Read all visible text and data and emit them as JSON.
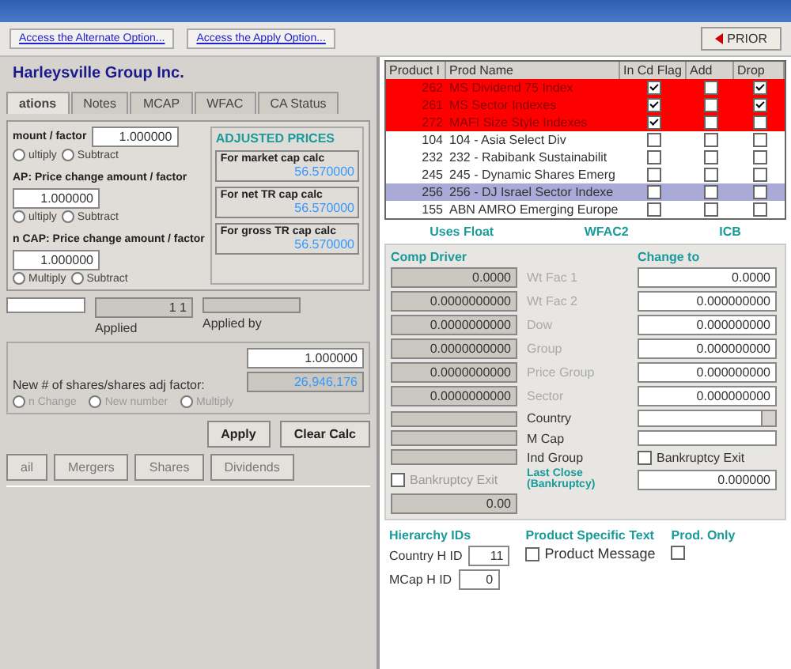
{
  "toolbar": {
    "links": [
      "Access the Alternate Option...",
      "Access the Apply Option..."
    ],
    "prior_button": "PRIOR"
  },
  "company_title": "Harleysville Group Inc.",
  "tabs": [
    {
      "label": "ations",
      "selected": true
    },
    {
      "label": "Notes",
      "selected": false
    },
    {
      "label": "MCAP",
      "selected": false
    },
    {
      "label": "WFAC",
      "selected": false
    },
    {
      "label": "CA Status",
      "selected": false
    }
  ],
  "price_adjustments": [
    {
      "label": "mount / factor",
      "options": [
        {
          "label": "ultiply",
          "selected": false
        },
        {
          "label": "Subtract",
          "selected": false
        }
      ],
      "value": "1.000000"
    },
    {
      "label": "AP: Price change amount / factor",
      "options": [
        {
          "label": "ultiply",
          "selected": false
        },
        {
          "label": "Subtract",
          "selected": false
        }
      ],
      "value": "1.000000"
    },
    {
      "label": "n CAP: Price change amount / factor",
      "options": [
        {
          "label": "Multiply",
          "selected": false
        },
        {
          "label": "Subtract",
          "selected": false
        }
      ],
      "value": "1.000000"
    }
  ],
  "adjusted_prices": {
    "title": "ADJUSTED PRICES",
    "items": [
      {
        "label": "For market cap calc",
        "value": "56.570000"
      },
      {
        "label": "For net TR cap calc",
        "value": "56.570000"
      },
      {
        "label": "For gross TR cap calc",
        "value": "56.570000"
      }
    ]
  },
  "applied": {
    "value": "1 1",
    "label": "Applied"
  },
  "applied_by": {
    "label": "Applied by"
  },
  "shares": {
    "label": "New # of shares/shares adj factor:",
    "value": "1.000000",
    "readout": "26,946,176",
    "options": [
      {
        "label": "n Change",
        "selected": false,
        "disabled": true
      },
      {
        "label": "New number",
        "selected": false,
        "disabled": true
      },
      {
        "label": "Multiply",
        "selected": false,
        "disabled": true
      }
    ]
  },
  "action_buttons": [
    "Apply",
    "Clear Calc"
  ],
  "bottom_tabs": [
    {
      "label": "ail",
      "selected": false
    },
    {
      "label": "Mergers",
      "selected": false
    },
    {
      "label": "Shares",
      "selected": false
    },
    {
      "label": "Dividends",
      "selected": false
    }
  ],
  "table": {
    "columns": [
      "Product I",
      "Prod Name",
      "In Cd Flag",
      "Add",
      "Drop"
    ],
    "rows": [
      {
        "id": "262",
        "name": "MS Dividend 75 Index",
        "flagged": true,
        "selected": false,
        "in_cd": true,
        "add": false,
        "drop": true
      },
      {
        "id": "261",
        "name": "MS Sector Indexes",
        "flagged": true,
        "selected": false,
        "in_cd": true,
        "add": false,
        "drop": true
      },
      {
        "id": "272",
        "name": "MAFI Size Style Indexes",
        "flagged": true,
        "selected": false,
        "in_cd": true,
        "add": false,
        "drop": false
      },
      {
        "id": "104",
        "name": "104 - Asia Select Div",
        "flagged": false,
        "selected": false,
        "in_cd": false,
        "add": false,
        "drop": false
      },
      {
        "id": "232",
        "name": "232 - Rabibank Sustainabilit",
        "flagged": false,
        "selected": false,
        "in_cd": false,
        "add": false,
        "drop": false
      },
      {
        "id": "245",
        "name": "245 - Dynamic Shares Emerg",
        "flagged": false,
        "selected": false,
        "in_cd": false,
        "add": false,
        "drop": false
      },
      {
        "id": "256",
        "name": "256 - DJ Israel Sector Indexe",
        "flagged": false,
        "selected": true,
        "in_cd": false,
        "add": false,
        "drop": false
      },
      {
        "id": "155",
        "name": "ABN AMRO Emerging Europe",
        "flagged": false,
        "selected": false,
        "in_cd": false,
        "add": false,
        "drop": false
      }
    ]
  },
  "section_labels": [
    "Uses Float",
    "WFAC2",
    "ICB"
  ],
  "comp_driver": {
    "title": "Comp Driver",
    "values": [
      "0.0000",
      "0.0000000000",
      "0.0000000000",
      "0.0000000000",
      "0.0000000000",
      "0.0000000000"
    ]
  },
  "factor_labels": [
    "Wt Fac 1",
    "Wt Fac 2",
    "Dow",
    "Group",
    "Price Group",
    "Sector"
  ],
  "change_to": {
    "title": "Change to",
    "values": [
      "0.0000",
      "0.000000000",
      "0.000000000",
      "0.000000000",
      "0.000000000",
      "0.000000000"
    ]
  },
  "classification_rows": [
    {
      "label": "Country",
      "kind": "dropdown"
    },
    {
      "label": "M Cap",
      "kind": "field"
    },
    {
      "label": "Ind Group",
      "kind": "checkbox"
    }
  ],
  "bankruptcy_left": {
    "label": "Bankruptcy Exit",
    "checked": false,
    "disabled": true,
    "value": "0.00"
  },
  "last_close": "Last Close (Bankruptcy)",
  "bankruptcy_right": {
    "label": "Bankruptcy Exit",
    "checked": false,
    "disabled": false,
    "value": "0.000000"
  },
  "hierarchy": {
    "title": "Hierarchy IDs",
    "items": [
      {
        "label": "Country H ID",
        "value": "11"
      },
      {
        "label": "MCap H ID",
        "value": "0"
      }
    ]
  },
  "product_text": {
    "title": "Product Specific Text",
    "checkbox": {
      "label": "Product Message",
      "checked": false
    }
  },
  "prod_only": {
    "label": "Prod. Only",
    "checked": false
  }
}
